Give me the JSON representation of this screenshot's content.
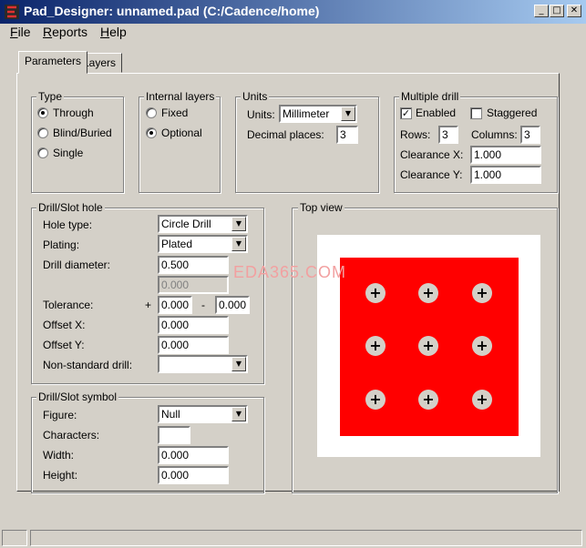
{
  "window": {
    "title": "Pad_Designer: unnamed.pad (C:/Cadence/home)",
    "min_symbol": "_",
    "max_symbol": "□",
    "close_symbol": "✕"
  },
  "menu": {
    "file": {
      "first": "F",
      "rest": "ile"
    },
    "reports": {
      "first": "R",
      "rest": "eports"
    },
    "help": {
      "first": "H",
      "rest": "elp"
    }
  },
  "tabs": {
    "parameters": "Parameters",
    "layers": "Layers"
  },
  "type_group": {
    "legend": "Type",
    "options": [
      "Through",
      "Blind/Buried",
      "Single"
    ],
    "selected": "Through"
  },
  "internal_layers": {
    "legend": "Internal layers",
    "options": [
      "Fixed",
      "Optional"
    ],
    "selected": "Optional"
  },
  "units": {
    "legend": "Units",
    "units_label": "Units:",
    "units_value": "Millimeter",
    "decimal_label": "Decimal places:",
    "decimal_value": "3"
  },
  "multiple_drill": {
    "legend": "Multiple drill",
    "enabled_label": "Enabled",
    "enabled_checked": "✓",
    "staggered_label": "Staggered",
    "rows_label": "Rows:",
    "rows_value": "3",
    "columns_label": "Columns:",
    "columns_value": "3",
    "clearance_x_label": "Clearance X:",
    "clearance_x_value": "1.000",
    "clearance_y_label": "Clearance Y:",
    "clearance_y_value": "1.000"
  },
  "drill_slot_hole": {
    "legend": "Drill/Slot hole",
    "hole_type_label": "Hole type:",
    "hole_type_value": "Circle Drill",
    "plating_label": "Plating:",
    "plating_value": "Plated",
    "drill_diameter_label": "Drill diameter:",
    "drill_diameter_value": "0.500",
    "secondary_value": "0.000",
    "tolerance_label": "Tolerance:",
    "plus_sign": "+",
    "minus_sign": "-",
    "tolerance_plus": "0.000",
    "tolerance_minus": "0.000",
    "offset_x_label": "Offset X:",
    "offset_x_value": "0.000",
    "offset_y_label": "Offset Y:",
    "offset_y_value": "0.000",
    "nonstandard_label": "Non-standard drill:",
    "nonstandard_value": ""
  },
  "drill_slot_symbol": {
    "legend": "Drill/Slot symbol",
    "figure_label": "Figure:",
    "figure_value": "Null",
    "characters_label": "Characters:",
    "characters_value": "",
    "width_label": "Width:",
    "width_value": "0.000",
    "height_label": "Height:",
    "height_value": "0.000"
  },
  "top_view": {
    "legend": "Top view",
    "watermark": "EDA365.COM",
    "drill_symbol": "+",
    "colors": {
      "pad": "#ff0000",
      "background": "#ffffff",
      "drill": "#d4d0c8"
    }
  },
  "icons": {
    "dropdown": "▼"
  }
}
